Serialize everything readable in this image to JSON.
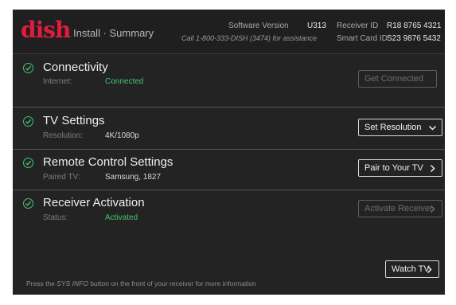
{
  "header": {
    "logo": "dish",
    "subtitle": "Install · Summary",
    "software_version_label": "Software Version",
    "software_version": "U313",
    "assistance": "Call 1-800-333-DISH (3474) for assistance",
    "receiver_id_label": "Receiver ID",
    "receiver_id": "R18 8765 4321",
    "smart_card_id_label": "Smart Card ID",
    "smart_card_id": "S23 9876 5432"
  },
  "sections": [
    {
      "title": "Connectivity",
      "label": "Internet:",
      "value": "Connected",
      "button": "Get Connected"
    },
    {
      "title": "TV Settings",
      "label": "Resolution:",
      "value": "4K/1080p",
      "button": "Set Resolution"
    },
    {
      "title": "Remote Control Settings",
      "label": "Paired TV:",
      "value": "Samsung, 1827",
      "button": "Pair to Your TV"
    },
    {
      "title": "Receiver Activation",
      "label": "Status:",
      "value": "Activated",
      "button": "Activate Receiver"
    }
  ],
  "footer": {
    "info_prefix": "Press the ",
    "info_emphasis": "SYS INFO",
    "info_suffix": " button on the front of your receiver for more information",
    "watch_button": "Watch TV"
  },
  "colors": {
    "accent_green": "#47c36f",
    "brand_red": "#e31c3d",
    "background": "#1d1d1d"
  }
}
